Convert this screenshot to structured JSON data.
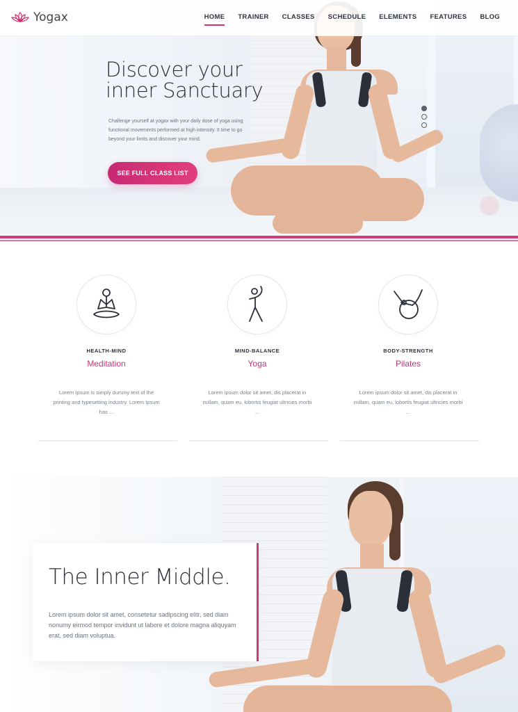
{
  "header": {
    "logo_text": "Yogax",
    "nav": [
      "HOME",
      "TRAINER",
      "CLASSES",
      "SCHEDULE",
      "ELEMENTS",
      "FEATURES",
      "BLOG"
    ],
    "active_nav": "HOME"
  },
  "hero": {
    "title_line1": "Discover your",
    "title_line2": "inner Sanctuary",
    "text": "Challenge yourself at yogax with your daily dose of yoga using functional movements performed at high intensity. It time to go beyond your limits and discover your mind.",
    "cta": "SEE FULL CLASS LIST",
    "slides": 3,
    "active_slide": 1
  },
  "features": [
    {
      "icon": "meditation-icon",
      "kicker": "HEALTH-MIND",
      "title": "Meditation",
      "text": "Lorem Ipsum is simply dummy text of the printing and typesetting industry. Lorem Ipsum has ..."
    },
    {
      "icon": "yoga-pose-icon",
      "kicker": "MIND-BALANCE",
      "title": "Yoga",
      "text": "Lorem ipsum dolor sit amet, dis placerat in nullam, quam eu, lobortis feugiat ultricies morbi ..."
    },
    {
      "icon": "pilates-ball-icon",
      "kicker": "BODY-STRENGTH",
      "title": "Pilates",
      "text": "Lorem ipsum dolor sit amet, dis placerat in nullam, quam eu, lobortis feugiat ultricies morbi ..."
    }
  ],
  "section2": {
    "title": "The Inner Middle.",
    "text": "Lorem ipsum dolor sit amet, consetetur sadipscing elitr, sed diam nonumy eirmod tempor invidunt ut labore et dolore magna aliquyam erat, sed diam voluptua."
  },
  "colors": {
    "accent": "#d4306f",
    "dark": "#2b2f3a"
  }
}
